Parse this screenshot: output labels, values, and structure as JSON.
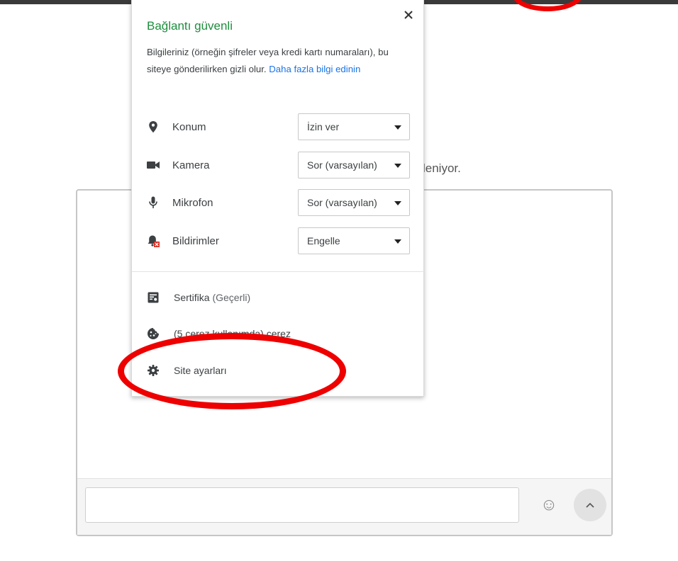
{
  "background": {
    "partial_text": "leniyor."
  },
  "popup": {
    "title": "Bağlantı güvenli",
    "desc_text": "Bilgileriniz (örneğin şifreler veya kredi kartı numaraları), bu siteye gönderilirken gizli olur. ",
    "desc_link": "Daha fazla bilgi edinin",
    "permissions": [
      {
        "icon": "location-pin-icon",
        "label": "Konum",
        "value": "İzin ver"
      },
      {
        "icon": "camera-icon",
        "label": "Kamera",
        "value": "Sor (varsayılan)"
      },
      {
        "icon": "microphone-icon",
        "label": "Mikrofon",
        "value": "Sor (varsayılan)"
      },
      {
        "icon": "notifications-blocked-icon",
        "label": "Bildirimler",
        "value": "Engelle"
      }
    ],
    "certificate": {
      "label": "Sertifika",
      "status": "(Geçerli)"
    },
    "cookies": {
      "label": "(5 çerez kullanımda) çerez"
    },
    "site_settings": {
      "label": "Site ayarları"
    }
  },
  "chat": {
    "emoji_glyph": "☺"
  },
  "colors": {
    "title_green": "#1e8e3e",
    "link_blue": "#1a73e8",
    "highlight_red": "#ee0000"
  }
}
